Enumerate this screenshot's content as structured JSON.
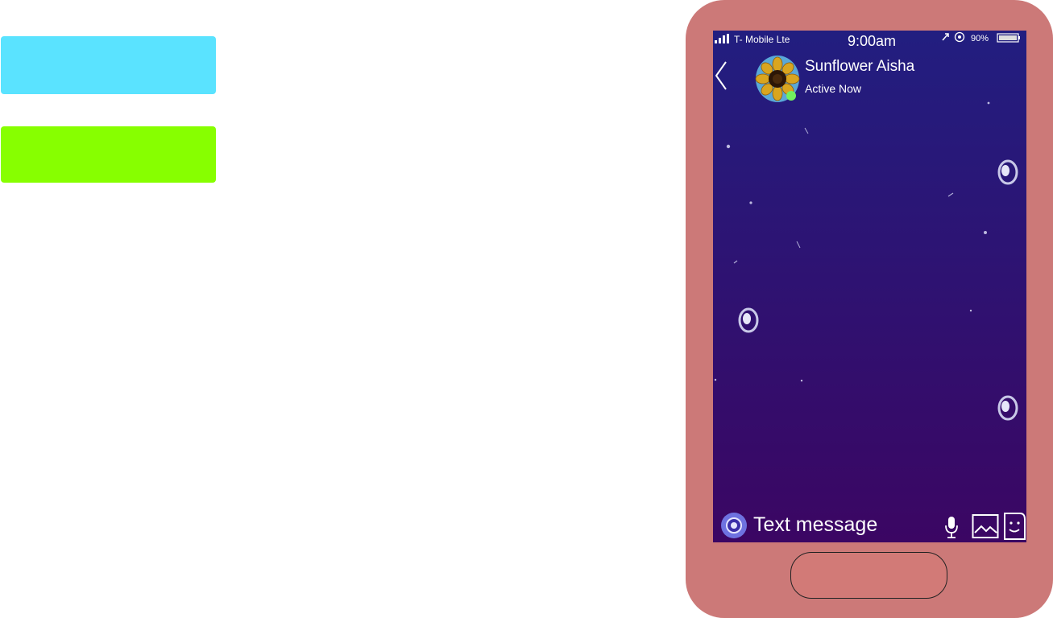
{
  "colors": {
    "swatch_top": "#5ae3ff",
    "swatch_bottom": "#87ff00",
    "phone_body": "#cc7978",
    "home_button": "#d27a77",
    "screen_top": "#221e80",
    "screen_bottom": "#3b0663",
    "online_dot": "#72f05f",
    "camera_button": "#6e72e0"
  },
  "status_bar": {
    "carrier": "T- Mobile Lte",
    "time": "9:00am",
    "battery": "90%",
    "icons": [
      "signal-icon",
      "alarm-icon",
      "data-icon",
      "battery-icon"
    ]
  },
  "header": {
    "back_icon": "chevron-left-icon",
    "avatar_icon": "sunflower-avatar",
    "contact_name": "Sunflower Aisha",
    "presence": "Active Now"
  },
  "composer": {
    "camera_icon": "camera-icon",
    "placeholder": "Text message",
    "mic_icon": "microphone-icon",
    "gallery_icon": "image-icon",
    "sticker_icon": "sticker-icon"
  }
}
